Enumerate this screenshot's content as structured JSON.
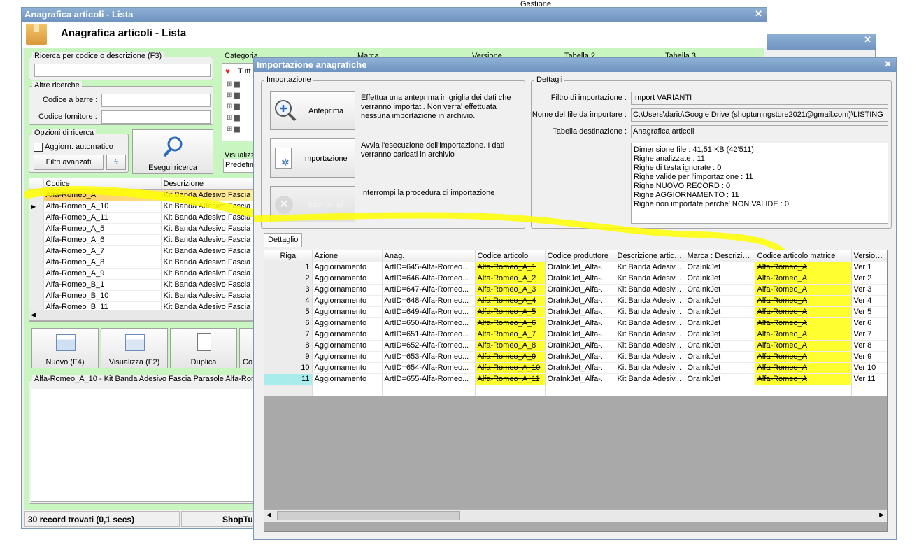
{
  "top_caption": "Gestione",
  "main_window": {
    "title": "Anagrafica articoli  - Lista",
    "heading": "Anagrafica articoli  - Lista",
    "search_group": "Ricerca per codice o descrizione (F3)",
    "category_label": "Categoria",
    "tab_headers": [
      "Marca",
      "Versione",
      "Tabella 2",
      "Tabella 3"
    ],
    "category_root": "Tutt",
    "other_search": "Altre ricerche",
    "barcode_label": "Codice a barre :",
    "supplier_code_label": "Codice fornitore :",
    "options_group": "Opzioni di ricerca",
    "auto_update": "Aggiorn. automatico",
    "advanced_filters": "Filtri avanzati",
    "search_button": "Esegui ricerca",
    "view_label": "Visualizz",
    "view_value": "Predefin",
    "list_columns": [
      "Codice",
      "Descrizione"
    ],
    "list_rows": [
      {
        "code": "Alfa-Romeo_A",
        "desc": "Kit Banda Adesivo Fascia Pa"
      },
      {
        "code": "Alfa-Romeo_A_10",
        "desc": "Kit Banda Adesivo Fascia Pa"
      },
      {
        "code": "Alfa-Romeo_A_11",
        "desc": "Kit Banda Adesivo Fascia Pa"
      },
      {
        "code": "Alfa-Romeo_A_5",
        "desc": "Kit Banda Adesivo Fascia Pa"
      },
      {
        "code": "Alfa-Romeo_A_6",
        "desc": "Kit Banda Adesivo Fascia Pa"
      },
      {
        "code": "Alfa-Romeo_A_7",
        "desc": "Kit Banda Adesivo Fascia Pa"
      },
      {
        "code": "Alfa-Romeo_A_8",
        "desc": "Kit Banda Adesivo Fascia Pa"
      },
      {
        "code": "Alfa-Romeo_A_9",
        "desc": "Kit Banda Adesivo Fascia Pa"
      },
      {
        "code": "Alfa-Romeo_B_1",
        "desc": "Kit Banda Adesivo Fascia Pa"
      },
      {
        "code": "Alfa-Romeo_B_10",
        "desc": "Kit Banda Adesivo Fascia Pa"
      },
      {
        "code": "Alfa-Romeo_B_11",
        "desc": "Kit Banda Adesivo Fascia Pa"
      }
    ],
    "actions": [
      "Nuovo (F4)",
      "Visualizza (F2)",
      "Duplica",
      "Co"
    ],
    "detail_title": "Alfa-Romeo_A_10 - Kit Banda Adesivo Fascia Parasole Alfa-Rome",
    "status_count": "30 record trovati (0,1 secs)",
    "status_shop": "ShopTur"
  },
  "import_window": {
    "title": "Importazione anagrafiche",
    "import_group": "Importazione",
    "preview_button": "Anteprima",
    "preview_desc": "Effettua una anteprima in griglia dei dati che verranno importati. Non verra' effettuata nessuna importazione in archivio.",
    "import_button": "Importazione",
    "import_desc": "Avvia l'esecuzione dell'importazione. I dati verranno caricati in archivio",
    "stop_button": "Interrompi",
    "stop_desc": "Interrompi la procedura di importazione",
    "details_group": "Dettagli",
    "filter_label": "Filtro di importazione :",
    "filter_value": "Import VARIANTI",
    "file_label": "Nome del file da importare :",
    "file_value": "C:\\Users\\dario\\Google Drive (shoptuningstore2021@gmail.com)\\LISTING",
    "table_label": "Tabella destinazione :",
    "table_value": "Anagrafica articoli",
    "stats": [
      "Dimensione file : 41,51 KB (42'511)",
      "Righe analizzate : 11",
      "Righe di testa ignorate : 0",
      "Righe valide per l'importazione : 11",
      "Righe NUOVO RECORD : 0",
      "Righe AGGIORNAMENTO  : 11",
      "Righe non importate perche' NON VALIDE : 0"
    ],
    "tab": "Dettaglio",
    "grid_columns": [
      "Riga",
      "Azione",
      "Anag.",
      "Codice articolo",
      "Codice produttore",
      "Descrizione articolo",
      "Marca : Descrizione",
      "Codice articolo matrice",
      "Versione :"
    ],
    "grid_rows": [
      [
        "1",
        "Aggiornamento",
        "ArtID=645-Alfa-Romeo...",
        "Alfa-Romeo_A_1",
        "OraInkJet_Alfa-...",
        "Kit Banda Adesiv...",
        "OraInkJet",
        "Alfa-Romeo_A",
        "Ver 1"
      ],
      [
        "2",
        "Aggiornamento",
        "ArtID=646-Alfa-Romeo...",
        "Alfa-Romeo_A_2",
        "OraInkJet_Alfa-...",
        "Kit Banda Adesiv...",
        "OraInkJet",
        "Alfa-Romeo_A",
        "Ver 2"
      ],
      [
        "3",
        "Aggiornamento",
        "ArtID=647-Alfa-Romeo...",
        "Alfa-Romeo_A_3",
        "OraInkJet_Alfa-...",
        "Kit Banda Adesiv...",
        "OraInkJet",
        "Alfa-Romeo_A",
        "Ver 3"
      ],
      [
        "4",
        "Aggiornamento",
        "ArtID=648-Alfa-Romeo...",
        "Alfa-Romeo_A_4",
        "OraInkJet_Alfa-...",
        "Kit Banda Adesiv...",
        "OraInkJet",
        "Alfa-Romeo_A",
        "Ver 4"
      ],
      [
        "5",
        "Aggiornamento",
        "ArtID=649-Alfa-Romeo...",
        "Alfa-Romeo_A_5",
        "OraInkJet_Alfa-...",
        "Kit Banda Adesiv...",
        "OraInkJet",
        "Alfa-Romeo_A",
        "Ver 5"
      ],
      [
        "6",
        "Aggiornamento",
        "ArtID=650-Alfa-Romeo...",
        "Alfa-Romeo_A_6",
        "OraInkJet_Alfa-...",
        "Kit Banda Adesiv...",
        "OraInkJet",
        "Alfa-Romeo_A",
        "Ver 6"
      ],
      [
        "7",
        "Aggiornamento",
        "ArtID=651-Alfa-Romeo...",
        "Alfa-Romeo_A_7",
        "OraInkJet_Alfa-...",
        "Kit Banda Adesiv...",
        "OraInkJet",
        "Alfa-Romeo_A",
        "Ver 7"
      ],
      [
        "8",
        "Aggiornamento",
        "ArtID=652-Alfa-Romeo...",
        "Alfa-Romeo_A_8",
        "OraInkJet_Alfa-...",
        "Kit Banda Adesiv...",
        "OraInkJet",
        "Alfa-Romeo_A",
        "Ver 8"
      ],
      [
        "9",
        "Aggiornamento",
        "ArtID=653-Alfa-Romeo...",
        "Alfa-Romeo_A_9",
        "OraInkJet_Alfa-...",
        "Kit Banda Adesiv...",
        "OraInkJet",
        "Alfa-Romeo_A",
        "Ver 9"
      ],
      [
        "10",
        "Aggiornamento",
        "ArtID=654-Alfa-Romeo...",
        "Alfa-Romeo_A_10",
        "OraInkJet_Alfa-...",
        "Kit Banda Adesiv...",
        "OraInkJet",
        "Alfa-Romeo_A",
        "Ver 10"
      ],
      [
        "11",
        "Aggiornamento",
        "ArtID=655-Alfa-Romeo...",
        "Alfa-Romeo_A_11",
        "OraInkJet_Alfa-...",
        "Kit Banda Adesiv...",
        "OraInkJet",
        "Alfa-Romeo_A",
        "Ver 11"
      ]
    ]
  }
}
